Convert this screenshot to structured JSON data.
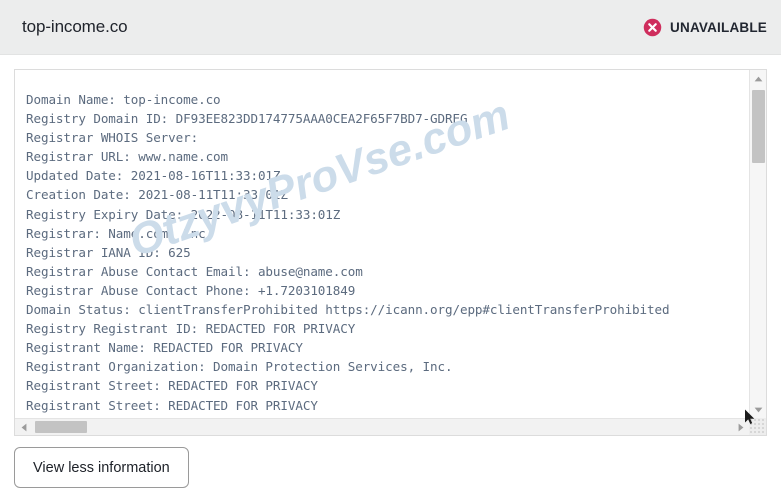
{
  "header": {
    "domain_title": "top-income.co",
    "status": {
      "label": "UNAVAILABLE",
      "icon": "circle-x-icon",
      "icon_color": "#cf2e5d",
      "text_color": "#222731"
    }
  },
  "whois": {
    "watermark": "OtzyvyProVse.com",
    "records": [
      {
        "key": "Domain Name",
        "value": "top-income.co"
      },
      {
        "key": "Registry Domain ID",
        "value": "DF93EE823DD174775AAA0CEA2F65F7BD7-GDREG"
      },
      {
        "key": "Registrar WHOIS Server",
        "value": ""
      },
      {
        "key": "Registrar URL",
        "value": "www.name.com"
      },
      {
        "key": "Updated Date",
        "value": "2021-08-16T11:33:01Z"
      },
      {
        "key": "Creation Date",
        "value": "2021-08-11T11:33:01Z"
      },
      {
        "key": "Registry Expiry Date",
        "value": "2022-08-11T11:33:01Z"
      },
      {
        "key": "Registrar",
        "value": "Name.com, Inc."
      },
      {
        "key": "Registrar IANA ID",
        "value": "625"
      },
      {
        "key": "Registrar Abuse Contact Email",
        "value": "abuse@name.com"
      },
      {
        "key": "Registrar Abuse Contact Phone",
        "value": "+1.7203101849"
      },
      {
        "key": "Domain Status",
        "value": "clientTransferProhibited https://icann.org/epp#clientTransferProhibited"
      },
      {
        "key": "Registry Registrant ID",
        "value": "REDACTED FOR PRIVACY"
      },
      {
        "key": "Registrant Name",
        "value": "REDACTED FOR PRIVACY"
      },
      {
        "key": "Registrant Organization",
        "value": "Domain Protection Services, Inc."
      },
      {
        "key": "Registrant Street",
        "value": "REDACTED FOR PRIVACY"
      },
      {
        "key": "Registrant Street",
        "value": "REDACTED FOR PRIVACY"
      }
    ],
    "text": "Domain Name: top-income.co\nRegistry Domain ID: DF93EE823DD174775AAA0CEA2F65F7BD7-GDREG\nRegistrar WHOIS Server:\nRegistrar URL: www.name.com\nUpdated Date: 2021-08-16T11:33:01Z\nCreation Date: 2021-08-11T11:33:01Z\nRegistry Expiry Date: 2022-08-11T11:33:01Z\nRegistrar: Name.com, Inc.\nRegistrar IANA ID: 625\nRegistrar Abuse Contact Email: abuse@name.com\nRegistrar Abuse Contact Phone: +1.7203101849\nDomain Status: clientTransferProhibited https://icann.org/epp#clientTransferProhibited\nRegistry Registrant ID: REDACTED FOR PRIVACY\nRegistrant Name: REDACTED FOR PRIVACY\nRegistrant Organization: Domain Protection Services, Inc.\nRegistrant Street: REDACTED FOR PRIVACY\nRegistrant Street: REDACTED FOR PRIVACY"
  },
  "scrollbars": {
    "vertical": {
      "up_icon": "triangle-up-icon",
      "down_icon": "triangle-down-icon"
    },
    "horizontal": {
      "left_icon": "triangle-left-icon",
      "right_icon": "triangle-right-icon"
    },
    "corner_icon": "resize-grip-icon"
  },
  "footer": {
    "view_less_label": "View less information"
  }
}
